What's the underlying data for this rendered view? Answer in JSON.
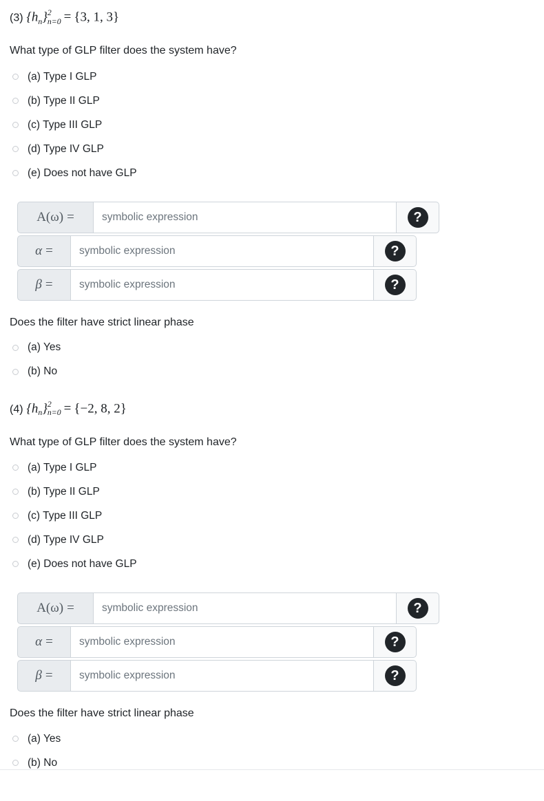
{
  "questions": [
    {
      "number": "(3)",
      "sequence_label": "{h",
      "sequence_sub": "n",
      "sequence_close": "}",
      "limit_sup": "2",
      "limit_sub": "n=0",
      "equals": "=",
      "values": "{3, 1, 3}",
      "type_prompt": "What type of GLP filter does the system have?",
      "type_options": [
        "(a) Type I GLP",
        "(b) Type II GLP",
        "(c) Type III GLP",
        "(d) Type IV GLP",
        "(e) Does not have GLP"
      ],
      "fields": [
        {
          "label_fn": "A(ω)",
          "label_sym": "",
          "equals": "=",
          "placeholder": "symbolic expression",
          "help_icon": "question-mark-icon",
          "help_label": "?"
        },
        {
          "label_fn": "",
          "label_sym": "α",
          "equals": "=",
          "placeholder": "symbolic expression",
          "help_icon": "question-mark-icon",
          "help_label": "?"
        },
        {
          "label_fn": "",
          "label_sym": "β",
          "equals": "=",
          "placeholder": "symbolic expression",
          "help_icon": "question-mark-icon",
          "help_label": "?"
        }
      ],
      "phase_prompt": "Does the filter have strict linear phase",
      "phase_options": [
        "(a) Yes",
        "(b) No"
      ]
    },
    {
      "number": "(4)",
      "sequence_label": "{h",
      "sequence_sub": "n",
      "sequence_close": "}",
      "limit_sup": "2",
      "limit_sub": "n=0",
      "equals": "=",
      "values": "{−2, 8, 2}",
      "type_prompt": "What type of GLP filter does the system have?",
      "type_options": [
        "(a) Type I GLP",
        "(b) Type II GLP",
        "(c) Type III GLP",
        "(d) Type IV GLP",
        "(e) Does not have GLP"
      ],
      "fields": [
        {
          "label_fn": "A(ω)",
          "label_sym": "",
          "equals": "=",
          "placeholder": "symbolic expression",
          "help_icon": "question-mark-icon",
          "help_label": "?"
        },
        {
          "label_fn": "",
          "label_sym": "α",
          "equals": "=",
          "placeholder": "symbolic expression",
          "help_icon": "question-mark-icon",
          "help_label": "?"
        },
        {
          "label_fn": "",
          "label_sym": "β",
          "equals": "=",
          "placeholder": "symbolic expression",
          "help_icon": "question-mark-icon",
          "help_label": "?"
        }
      ],
      "phase_prompt": "Does the filter have strict linear phase",
      "phase_options": [
        "(a) Yes",
        "(b) No"
      ]
    }
  ],
  "colors": {
    "text": "#212529",
    "placeholder": "#6c757d",
    "prefix_bg": "#e9ecef",
    "border": "#ced4da",
    "help_bg": "#f8f9fa",
    "badge": "#212529"
  }
}
